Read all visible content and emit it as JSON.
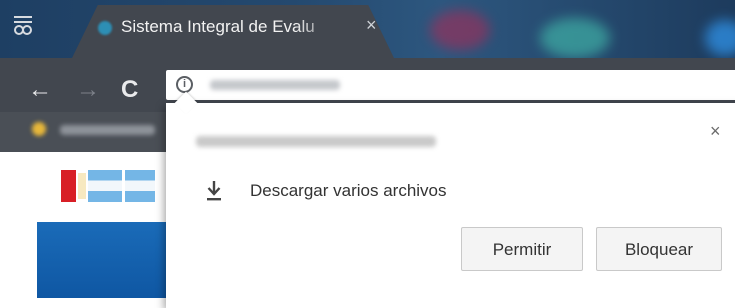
{
  "browser": {
    "tab": {
      "title": "Sistema Integral de Evalu",
      "close_icon": "×",
      "favicon": "site-favicon"
    },
    "toolbar": {
      "back_icon": "←",
      "forward_icon": "→",
      "reload_icon": "C",
      "site_info_icon": "i"
    }
  },
  "permission_popup": {
    "close_icon": "×",
    "request_icon": "download-icon",
    "request_text": "Descargar varios archivos",
    "allow_label": "Permitir",
    "block_label": "Bloquear"
  },
  "colors": {
    "tab_strip": "#24496f",
    "toolbar": "#42474f",
    "banner_blue": "#0f57a3"
  }
}
